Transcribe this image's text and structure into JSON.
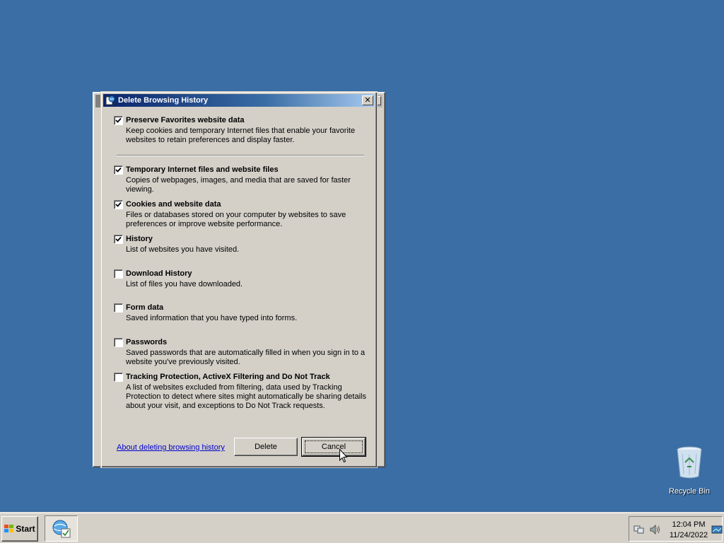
{
  "dialog": {
    "title": "Delete Browsing History",
    "close_symbol": "✕",
    "options": [
      {
        "label": "Preserve Favorites website data",
        "description": "Keep cookies and temporary Internet files that enable your favorite websites to retain preferences and display faster.",
        "checked": true
      },
      {
        "label": "Temporary Internet files and website files",
        "description": "Copies of webpages, images, and media that are saved for faster viewing.",
        "checked": true
      },
      {
        "label": "Cookies and website data",
        "description": "Files or databases stored on your computer by websites to save preferences or improve website performance.",
        "checked": true
      },
      {
        "label": "History",
        "description": "List of websites you have visited.",
        "checked": true
      },
      {
        "label": "Download History",
        "description": "List of files you have downloaded.",
        "checked": false
      },
      {
        "label": "Form data",
        "description": "Saved information that you have typed into forms.",
        "checked": false
      },
      {
        "label": "Passwords",
        "description": "Saved passwords that are automatically filled in when you sign in to a website you've previously visited.",
        "checked": false
      },
      {
        "label": "Tracking Protection, ActiveX Filtering and Do Not Track",
        "description": "A list of websites excluded from filtering, data used by Tracking Protection to detect where sites might automatically be sharing details about your visit, and exceptions to Do Not Track requests.",
        "checked": false
      }
    ],
    "about_link": "About deleting browsing history",
    "delete_label": "Delete",
    "cancel_label": "Cancel"
  },
  "desktop": {
    "recycle_bin_label": "Recycle Bin"
  },
  "taskbar": {
    "start_label": "Start",
    "clock_time": "12:04 PM",
    "clock_date": "11/24/2022"
  },
  "icons": {
    "dialog": "ie-delete-history-icon",
    "checkbox": "checkmark-icon",
    "recycle": "recycle-bin-icon",
    "start": "windows-flag-icon",
    "task": "internet-explorer-icon",
    "tray": [
      "network-icon",
      "volume-icon",
      "show-desktop-icon"
    ]
  },
  "colors": {
    "desktop": "#3a6ea5",
    "titlebar_start": "#0a246a",
    "titlebar_end": "#a6caf0",
    "face": "#d4d0c8",
    "link": "#0000cc"
  }
}
